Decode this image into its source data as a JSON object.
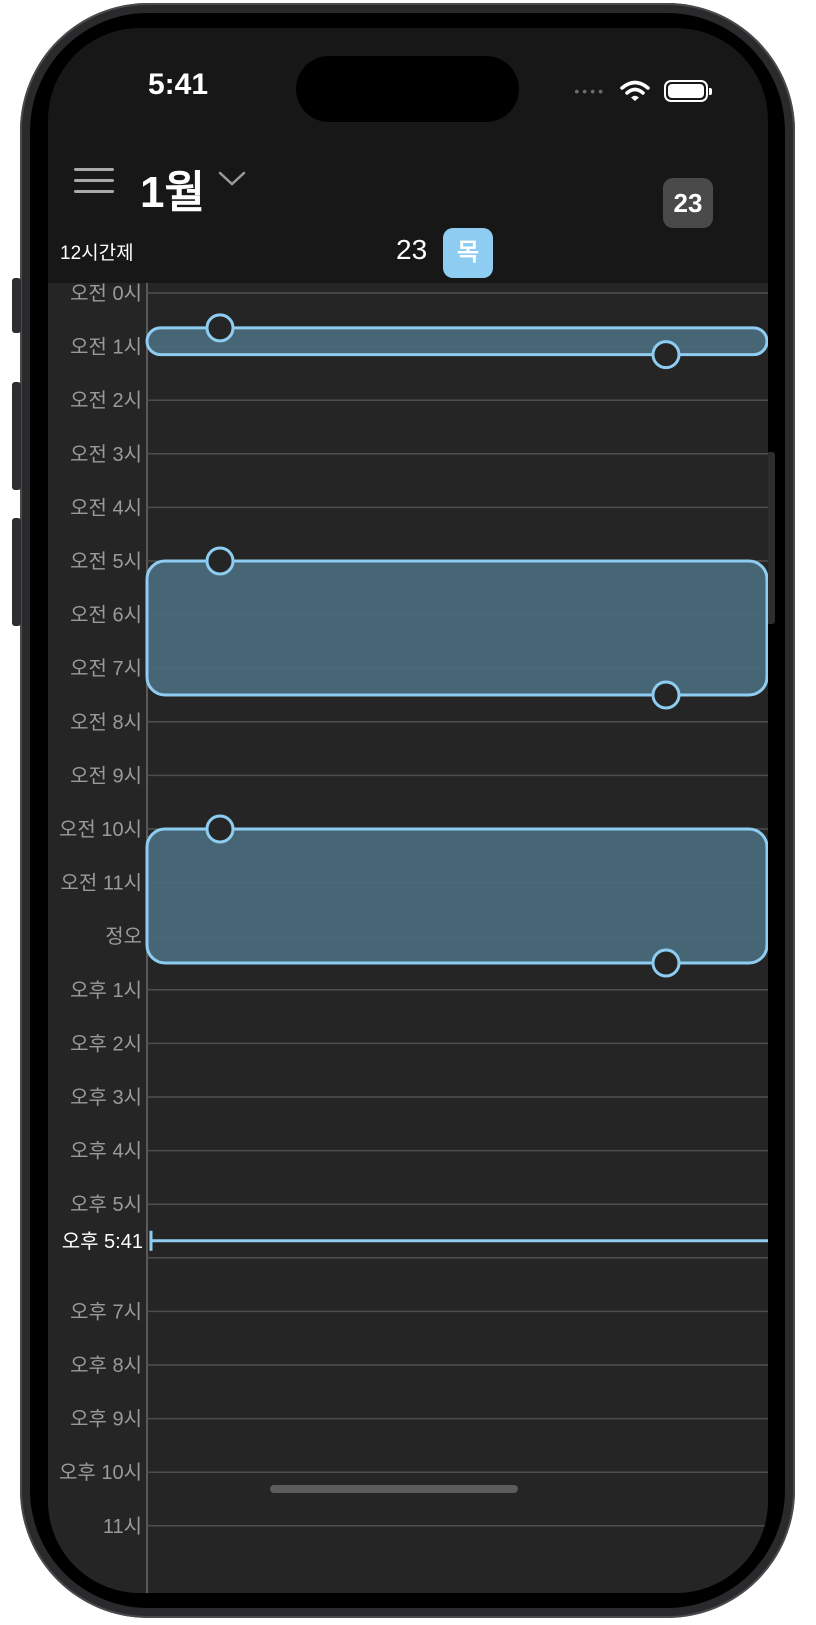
{
  "status_bar": {
    "time": "5:41"
  },
  "header": {
    "month": "1월",
    "today_badge": "23"
  },
  "day_header": {
    "format_toggle": "12시간제",
    "day_number": "23",
    "weekday": "목"
  },
  "hours": [
    "오전 0시",
    "오전 1시",
    "오전 2시",
    "오전 3시",
    "오전 4시",
    "오전 5시",
    "오전 6시",
    "오전 7시",
    "오전 8시",
    "오전 9시",
    "오전 10시",
    "오전 11시",
    "정오",
    "오후 1시",
    "오후 2시",
    "오후 3시",
    "오후 4시",
    "오후 5시",
    "",
    "오후 7시",
    "오후 8시",
    "오후 9시",
    "오후 10시",
    "11시"
  ],
  "now_indicator": {
    "label": "오후 5:41",
    "hour": 17.683
  },
  "events": [
    {
      "start_hour": 0.65,
      "end_hour": 1.15
    },
    {
      "start_hour": 5.0,
      "end_hour": 7.5
    },
    {
      "start_hour": 10.0,
      "end_hour": 12.5
    }
  ],
  "colors": {
    "accent": "#8ecdf1",
    "event_fill": "#4a6b7c",
    "background": "#252525",
    "header_bg": "#171717"
  }
}
